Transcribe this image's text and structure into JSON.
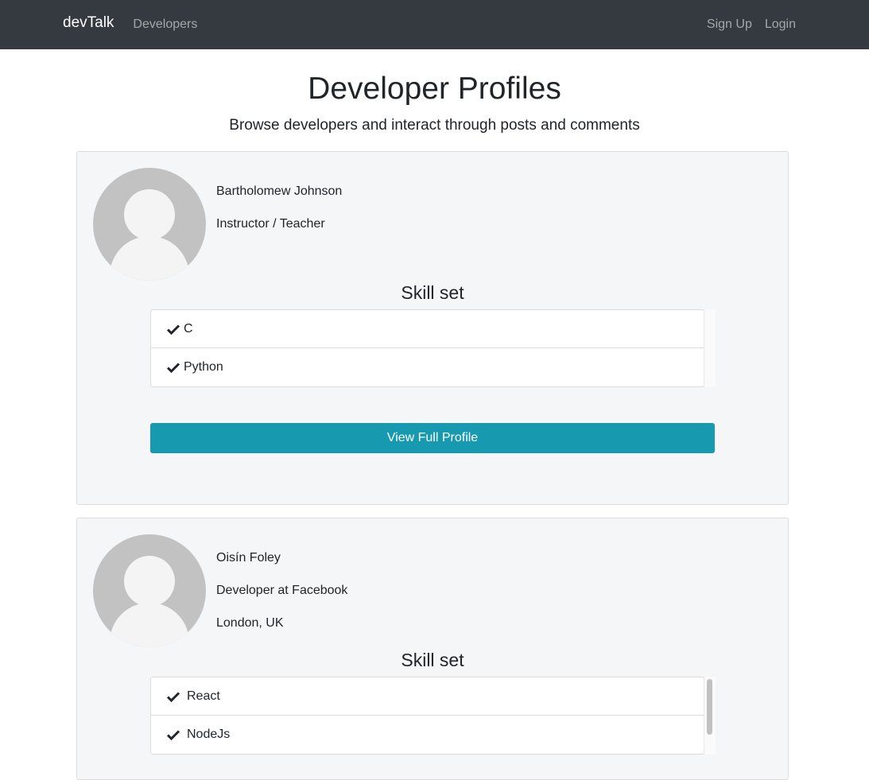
{
  "nav": {
    "brand": "devTalk",
    "developers": "Developers",
    "signup": "Sign Up",
    "login": "Login"
  },
  "header": {
    "title": "Developer Profiles",
    "subtitle": "Browse developers and interact through posts and comments"
  },
  "profiles": [
    {
      "name": "Bartholomew Johnson",
      "status": "Instructor / Teacher",
      "skills_heading": "Skill set",
      "skills": [
        "C",
        "Python"
      ],
      "button": "View Full Profile"
    },
    {
      "name": "Oisín Foley",
      "status": "Developer at Facebook",
      "location": "London, UK",
      "skills_heading": "Skill set",
      "skills": [
        "React",
        "NodeJs"
      ]
    }
  ],
  "colors": {
    "navbar": "#343a40",
    "accent_button": "#1799b0",
    "card_bg": "#f5f6f8"
  }
}
